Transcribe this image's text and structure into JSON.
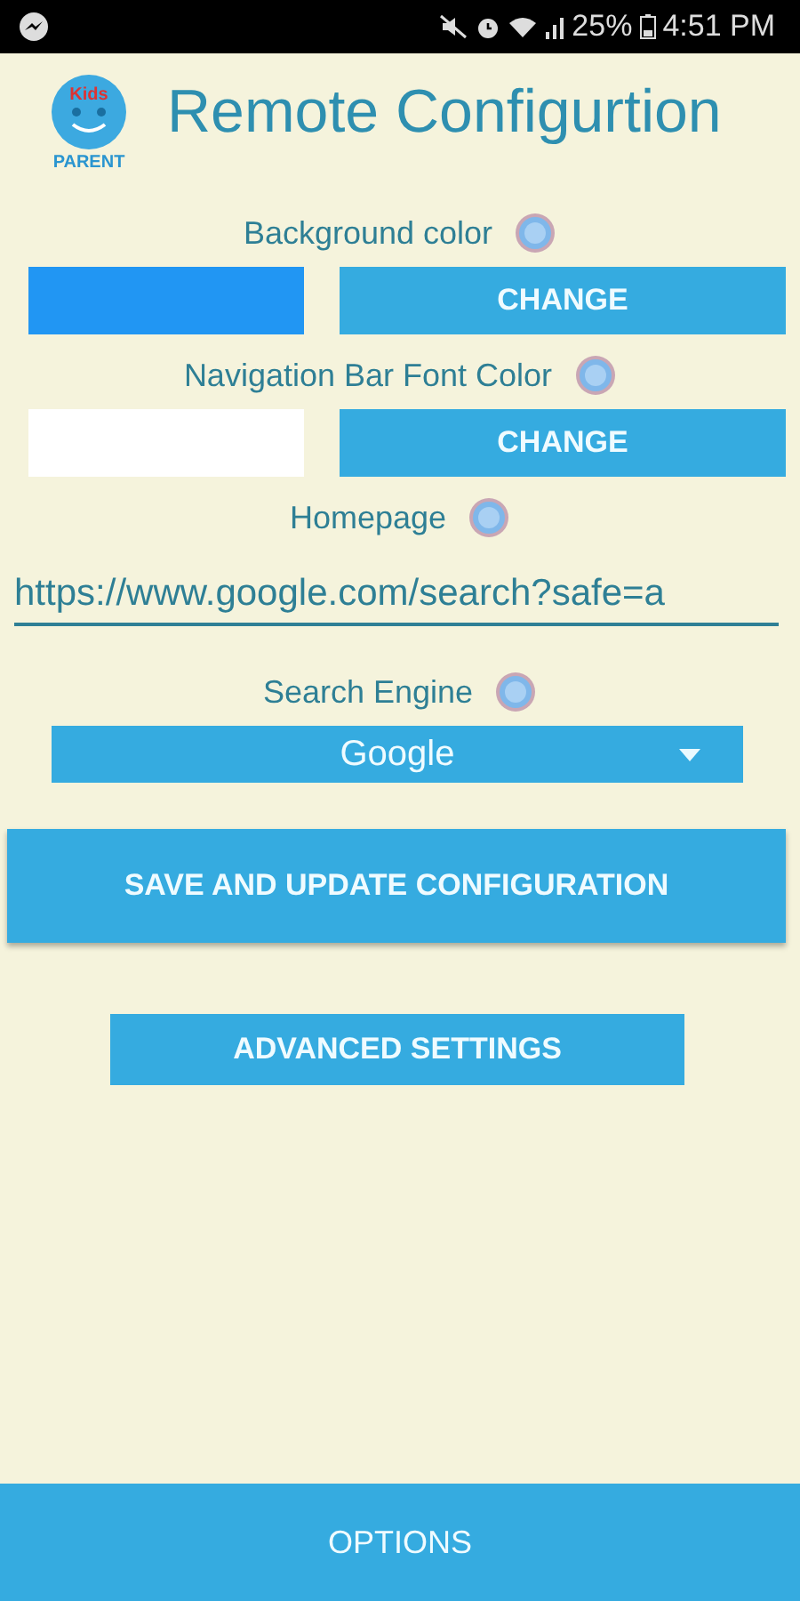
{
  "status_bar": {
    "battery": "25%",
    "time": "4:51 PM"
  },
  "header": {
    "logo_top": "Kids",
    "logo_bottom": "PARENT",
    "title": "Remote Configurtion"
  },
  "color_settings": [
    {
      "label": "Background color",
      "color": "#2196f3",
      "button": "CHANGE"
    },
    {
      "label": "Navigation Bar Font Color",
      "color": "#ffffff",
      "button": "CHANGE"
    }
  ],
  "homepage": {
    "label": "Homepage",
    "value": "https://www.google.com/search?safe=a"
  },
  "search_engine": {
    "label": "Search Engine",
    "value": "Google"
  },
  "save_button": "SAVE AND UPDATE CONFIGURATION",
  "advanced_button": "ADVANCED SETTINGS",
  "bottom_bar": "OPTIONS"
}
